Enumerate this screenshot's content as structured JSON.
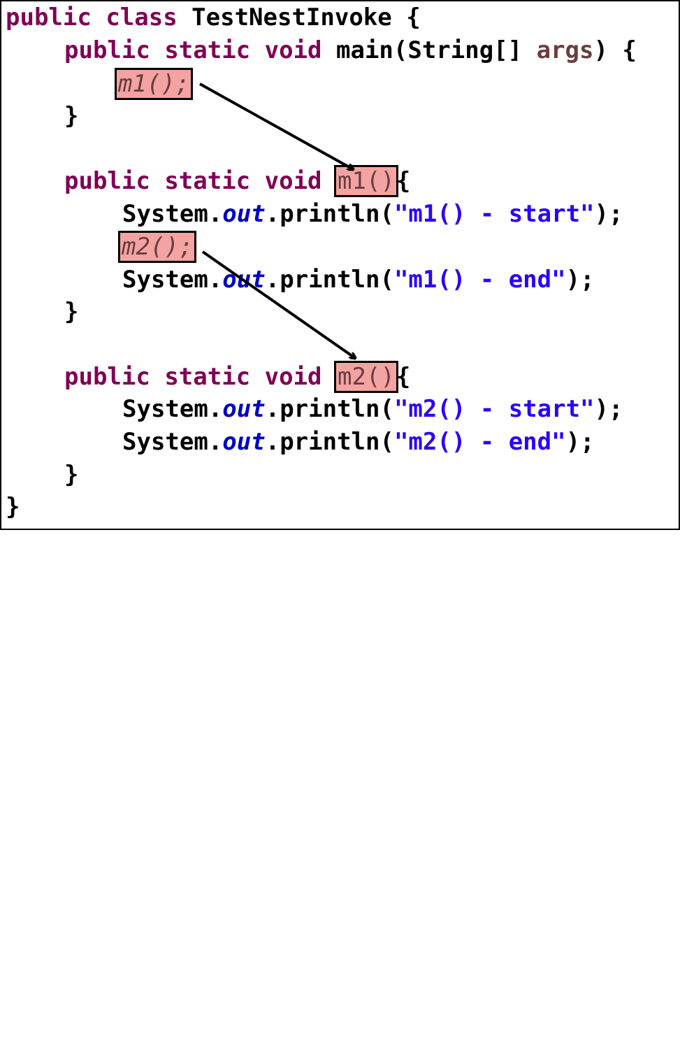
{
  "code": {
    "l1": {
      "kw1": "public",
      "kw2": "class",
      "name": "TestNestInvoke",
      "brace": "{"
    },
    "l2": {
      "kw1": "public",
      "kw2": "static",
      "kw3": "void",
      "pre": "main(String[]",
      "args": "args",
      "post": ") {"
    },
    "l3": {
      "call": "m1();"
    },
    "l4": {
      "text": "}"
    },
    "l6": {
      "kw1": "public",
      "kw2": "static",
      "kw3": "void",
      "sig": "m1()",
      "brace": "{"
    },
    "l7": {
      "pre": "System.",
      "field": "out",
      "mid": ".println(",
      "str": "\"m1() - start\"",
      "end": ");"
    },
    "l8": {
      "call": "m2();"
    },
    "l9": {
      "pre": "System.",
      "field": "out",
      "mid": ".println(",
      "str": "\"m1() - end\"",
      "end": ");"
    },
    "l10": {
      "text": "}"
    },
    "l12": {
      "kw1": "public",
      "kw2": "static",
      "kw3": "void",
      "sig": "m2()",
      "brace": "{"
    },
    "l13": {
      "pre": "System.",
      "field": "out",
      "mid": ".println(",
      "str": "\"m2() - start\"",
      "end": ");"
    },
    "l14": {
      "pre": "System.",
      "field": "out",
      "mid": ".println(",
      "str": "\"m2() - end\"",
      "end": ");"
    },
    "l15": {
      "text": "}"
    },
    "l16": {
      "text": "}"
    }
  },
  "colors": {
    "keyword": "#7f0055",
    "string": "#2a00ff",
    "field": "#0000c0",
    "highlight": "#f4a3a3"
  }
}
